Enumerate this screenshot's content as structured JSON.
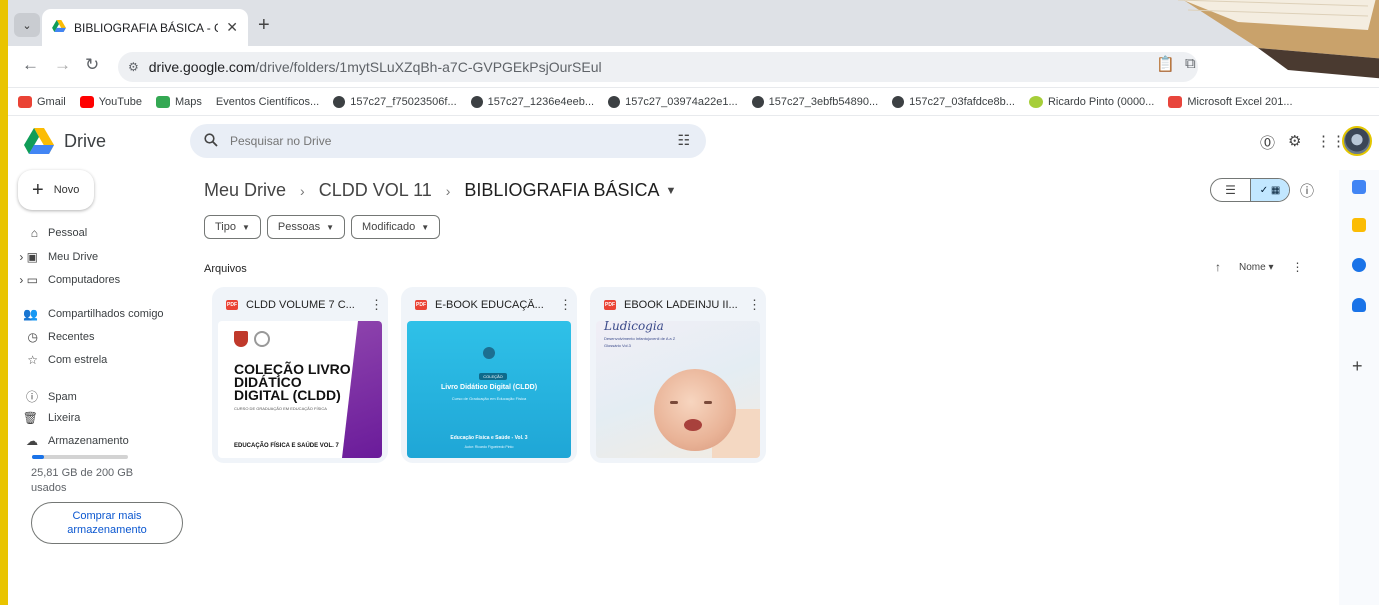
{
  "browser": {
    "tab_title": "BIBLIOGRAFIA BÁSICA - Google",
    "url_host": "drive.google.com",
    "url_path": "/drive/folders/1mytSLuXZqBh-a7C-GVPGEkPsjOurSEul",
    "bookmarks": [
      {
        "label": "Gmail",
        "icon": "gmail-icon",
        "color": "#ea4335"
      },
      {
        "label": "YouTube",
        "icon": "youtube-icon",
        "color": "#ff0000"
      },
      {
        "label": "Maps",
        "icon": "maps-icon",
        "color": "#34a853"
      },
      {
        "label": "Eventos Científicos...",
        "icon": "",
        "color": ""
      },
      {
        "label": "157c27_f75023506f...",
        "icon": "globe-icon",
        "color": "#3c4043"
      },
      {
        "label": "157c27_1236e4eeb...",
        "icon": "globe-icon",
        "color": "#3c4043"
      },
      {
        "label": "157c27_03974a22e1...",
        "icon": "globe-icon",
        "color": "#3c4043"
      },
      {
        "label": "157c27_3ebfb54890...",
        "icon": "globe-icon",
        "color": "#3c4043"
      },
      {
        "label": "157c27_03fafdce8b...",
        "icon": "globe-icon",
        "color": "#3c4043"
      },
      {
        "label": "Ricardo Pinto (0000...",
        "icon": "orcid-icon",
        "color": "#a6ce39"
      },
      {
        "label": "Microsoft Excel 201...",
        "icon": "excel-icon",
        "color": "#e8453c"
      }
    ]
  },
  "drive": {
    "app_name": "Drive",
    "search_placeholder": "Pesquisar no Drive",
    "new_label": "Novo",
    "sidebar": [
      {
        "label": "Pessoal",
        "icon": "home-icon"
      },
      {
        "label": "Meu Drive",
        "icon": "my-drive-icon"
      },
      {
        "label": "Computadores",
        "icon": "computers-icon"
      },
      {
        "label": "Compartilhados comigo",
        "icon": "shared-icon"
      },
      {
        "label": "Recentes",
        "icon": "clock-icon"
      },
      {
        "label": "Com estrela",
        "icon": "star-icon"
      },
      {
        "label": "Spam",
        "icon": "spam-icon"
      },
      {
        "label": "Lixeira",
        "icon": "trash-icon"
      },
      {
        "label": "Armazenamento",
        "icon": "cloud-icon"
      }
    ],
    "storage": {
      "used_text": "25,81 GB de 200 GB usados",
      "used_fraction": 0.13,
      "buy_label": "Comprar mais armazenamento"
    },
    "breadcrumb": [
      "Meu Drive",
      "CLDD VOL 11",
      "BIBLIOGRAFIA BÁSICA"
    ],
    "filters": [
      "Tipo",
      "Pessoas",
      "Modificado"
    ],
    "section_label": "Arquivos",
    "sort_label": "Nome",
    "files": [
      {
        "name": "CLDD VOLUME 7 C...",
        "type": "pdf",
        "thumb": {
          "title": "COLEÇÃO LIVRO DIDÁTICO DIGITAL (CLDD)",
          "subtitle": "CURSO DE GRADUAÇÃO EM EDUCAÇÃO FÍSICA",
          "footer": "EDUCAÇÃO FÍSICA E SAÚDE VOL. 7"
        }
      },
      {
        "name": "E-BOOK EDUCAÇÃ...",
        "type": "pdf",
        "thumb": {
          "badge": "COLEÇÃO",
          "title": "Livro Didático Digital (CLDD)",
          "subtitle": "Curso de Graduação em Educação Física",
          "footer": "Educação Física e Saúde - Vol. 3",
          "author": "Autor: Ricardo Figueiredo Pinto"
        }
      },
      {
        "name": "EBOOK LADEINJU II...",
        "type": "pdf",
        "thumb": {
          "script": "Ludicogia",
          "line1": "Desenvolvimento Infantojuvenil de A a Z",
          "line2": "Glossário Vol.3"
        }
      }
    ]
  }
}
